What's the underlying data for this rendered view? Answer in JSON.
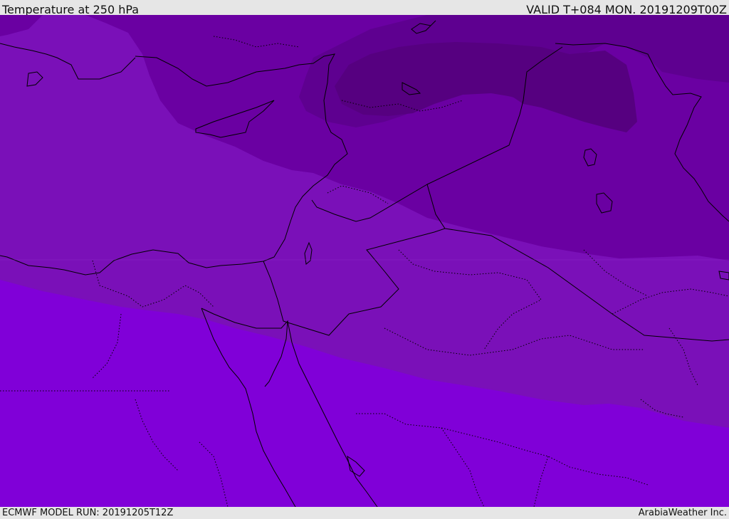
{
  "header": {
    "title": "Temperature at 250 hPa",
    "valid": "VALID T+084 MON. 20191209T00Z"
  },
  "footer": {
    "model_run": "ECMWF MODEL RUN: 20191205T12Z",
    "credit": "ArabiaWeather Inc."
  },
  "map": {
    "colors": {
      "band_warmest": "#8000d8",
      "band_mid": "#7a10b8",
      "band_cool": "#6a00a2",
      "band_cooler": "#5e0090",
      "band_coldest": "#560080",
      "coastline": "#000000",
      "border": "#000000"
    }
  }
}
